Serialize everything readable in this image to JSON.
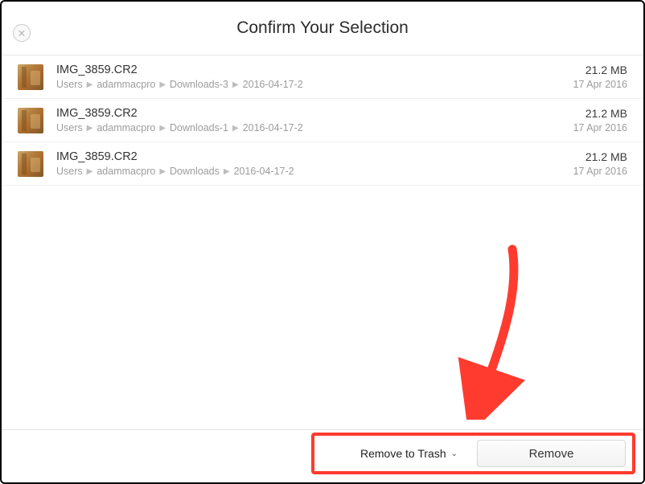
{
  "header": {
    "title": "Confirm Your Selection",
    "close_glyph": "✕"
  },
  "files": [
    {
      "name": "IMG_3859.CR2",
      "path": [
        "Users",
        "adammacpro",
        "Downloads-3",
        "2016-04-17-2"
      ],
      "size": "21.2 MB",
      "date": "17 Apr 2016"
    },
    {
      "name": "IMG_3859.CR2",
      "path": [
        "Users",
        "adammacpro",
        "Downloads-1",
        "2016-04-17-2"
      ],
      "size": "21.2 MB",
      "date": "17 Apr 2016"
    },
    {
      "name": "IMG_3859.CR2",
      "path": [
        "Users",
        "adammacpro",
        "Downloads",
        "2016-04-17-2"
      ],
      "size": "21.2 MB",
      "date": "17 Apr 2016"
    }
  ],
  "footer": {
    "dropdown_label": "Remove to Trash",
    "remove_label": "Remove"
  },
  "annotation": {
    "arrow_color": "#ff3b2f"
  }
}
